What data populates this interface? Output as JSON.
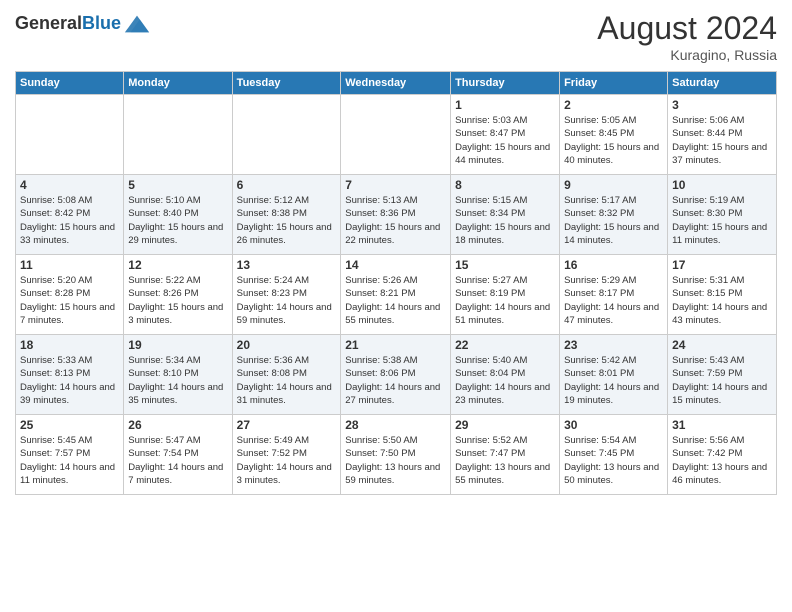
{
  "header": {
    "logo_general": "General",
    "logo_blue": "Blue",
    "month_year": "August 2024",
    "location": "Kuragino, Russia"
  },
  "days_of_week": [
    "Sunday",
    "Monday",
    "Tuesday",
    "Wednesday",
    "Thursday",
    "Friday",
    "Saturday"
  ],
  "weeks": [
    [
      {
        "day": "",
        "sunrise": "",
        "sunset": "",
        "daylight": ""
      },
      {
        "day": "",
        "sunrise": "",
        "sunset": "",
        "daylight": ""
      },
      {
        "day": "",
        "sunrise": "",
        "sunset": "",
        "daylight": ""
      },
      {
        "day": "",
        "sunrise": "",
        "sunset": "",
        "daylight": ""
      },
      {
        "day": "1",
        "sunrise": "Sunrise: 5:03 AM",
        "sunset": "Sunset: 8:47 PM",
        "daylight": "Daylight: 15 hours and 44 minutes."
      },
      {
        "day": "2",
        "sunrise": "Sunrise: 5:05 AM",
        "sunset": "Sunset: 8:45 PM",
        "daylight": "Daylight: 15 hours and 40 minutes."
      },
      {
        "day": "3",
        "sunrise": "Sunrise: 5:06 AM",
        "sunset": "Sunset: 8:44 PM",
        "daylight": "Daylight: 15 hours and 37 minutes."
      }
    ],
    [
      {
        "day": "4",
        "sunrise": "Sunrise: 5:08 AM",
        "sunset": "Sunset: 8:42 PM",
        "daylight": "Daylight: 15 hours and 33 minutes."
      },
      {
        "day": "5",
        "sunrise": "Sunrise: 5:10 AM",
        "sunset": "Sunset: 8:40 PM",
        "daylight": "Daylight: 15 hours and 29 minutes."
      },
      {
        "day": "6",
        "sunrise": "Sunrise: 5:12 AM",
        "sunset": "Sunset: 8:38 PM",
        "daylight": "Daylight: 15 hours and 26 minutes."
      },
      {
        "day": "7",
        "sunrise": "Sunrise: 5:13 AM",
        "sunset": "Sunset: 8:36 PM",
        "daylight": "Daylight: 15 hours and 22 minutes."
      },
      {
        "day": "8",
        "sunrise": "Sunrise: 5:15 AM",
        "sunset": "Sunset: 8:34 PM",
        "daylight": "Daylight: 15 hours and 18 minutes."
      },
      {
        "day": "9",
        "sunrise": "Sunrise: 5:17 AM",
        "sunset": "Sunset: 8:32 PM",
        "daylight": "Daylight: 15 hours and 14 minutes."
      },
      {
        "day": "10",
        "sunrise": "Sunrise: 5:19 AM",
        "sunset": "Sunset: 8:30 PM",
        "daylight": "Daylight: 15 hours and 11 minutes."
      }
    ],
    [
      {
        "day": "11",
        "sunrise": "Sunrise: 5:20 AM",
        "sunset": "Sunset: 8:28 PM",
        "daylight": "Daylight: 15 hours and 7 minutes."
      },
      {
        "day": "12",
        "sunrise": "Sunrise: 5:22 AM",
        "sunset": "Sunset: 8:26 PM",
        "daylight": "Daylight: 15 hours and 3 minutes."
      },
      {
        "day": "13",
        "sunrise": "Sunrise: 5:24 AM",
        "sunset": "Sunset: 8:23 PM",
        "daylight": "Daylight: 14 hours and 59 minutes."
      },
      {
        "day": "14",
        "sunrise": "Sunrise: 5:26 AM",
        "sunset": "Sunset: 8:21 PM",
        "daylight": "Daylight: 14 hours and 55 minutes."
      },
      {
        "day": "15",
        "sunrise": "Sunrise: 5:27 AM",
        "sunset": "Sunset: 8:19 PM",
        "daylight": "Daylight: 14 hours and 51 minutes."
      },
      {
        "day": "16",
        "sunrise": "Sunrise: 5:29 AM",
        "sunset": "Sunset: 8:17 PM",
        "daylight": "Daylight: 14 hours and 47 minutes."
      },
      {
        "day": "17",
        "sunrise": "Sunrise: 5:31 AM",
        "sunset": "Sunset: 8:15 PM",
        "daylight": "Daylight: 14 hours and 43 minutes."
      }
    ],
    [
      {
        "day": "18",
        "sunrise": "Sunrise: 5:33 AM",
        "sunset": "Sunset: 8:13 PM",
        "daylight": "Daylight: 14 hours and 39 minutes."
      },
      {
        "day": "19",
        "sunrise": "Sunrise: 5:34 AM",
        "sunset": "Sunset: 8:10 PM",
        "daylight": "Daylight: 14 hours and 35 minutes."
      },
      {
        "day": "20",
        "sunrise": "Sunrise: 5:36 AM",
        "sunset": "Sunset: 8:08 PM",
        "daylight": "Daylight: 14 hours and 31 minutes."
      },
      {
        "day": "21",
        "sunrise": "Sunrise: 5:38 AM",
        "sunset": "Sunset: 8:06 PM",
        "daylight": "Daylight: 14 hours and 27 minutes."
      },
      {
        "day": "22",
        "sunrise": "Sunrise: 5:40 AM",
        "sunset": "Sunset: 8:04 PM",
        "daylight": "Daylight: 14 hours and 23 minutes."
      },
      {
        "day": "23",
        "sunrise": "Sunrise: 5:42 AM",
        "sunset": "Sunset: 8:01 PM",
        "daylight": "Daylight: 14 hours and 19 minutes."
      },
      {
        "day": "24",
        "sunrise": "Sunrise: 5:43 AM",
        "sunset": "Sunset: 7:59 PM",
        "daylight": "Daylight: 14 hours and 15 minutes."
      }
    ],
    [
      {
        "day": "25",
        "sunrise": "Sunrise: 5:45 AM",
        "sunset": "Sunset: 7:57 PM",
        "daylight": "Daylight: 14 hours and 11 minutes."
      },
      {
        "day": "26",
        "sunrise": "Sunrise: 5:47 AM",
        "sunset": "Sunset: 7:54 PM",
        "daylight": "Daylight: 14 hours and 7 minutes."
      },
      {
        "day": "27",
        "sunrise": "Sunrise: 5:49 AM",
        "sunset": "Sunset: 7:52 PM",
        "daylight": "Daylight: 14 hours and 3 minutes."
      },
      {
        "day": "28",
        "sunrise": "Sunrise: 5:50 AM",
        "sunset": "Sunset: 7:50 PM",
        "daylight": "Daylight: 13 hours and 59 minutes."
      },
      {
        "day": "29",
        "sunrise": "Sunrise: 5:52 AM",
        "sunset": "Sunset: 7:47 PM",
        "daylight": "Daylight: 13 hours and 55 minutes."
      },
      {
        "day": "30",
        "sunrise": "Sunrise: 5:54 AM",
        "sunset": "Sunset: 7:45 PM",
        "daylight": "Daylight: 13 hours and 50 minutes."
      },
      {
        "day": "31",
        "sunrise": "Sunrise: 5:56 AM",
        "sunset": "Sunset: 7:42 PM",
        "daylight": "Daylight: 13 hours and 46 minutes."
      }
    ]
  ]
}
